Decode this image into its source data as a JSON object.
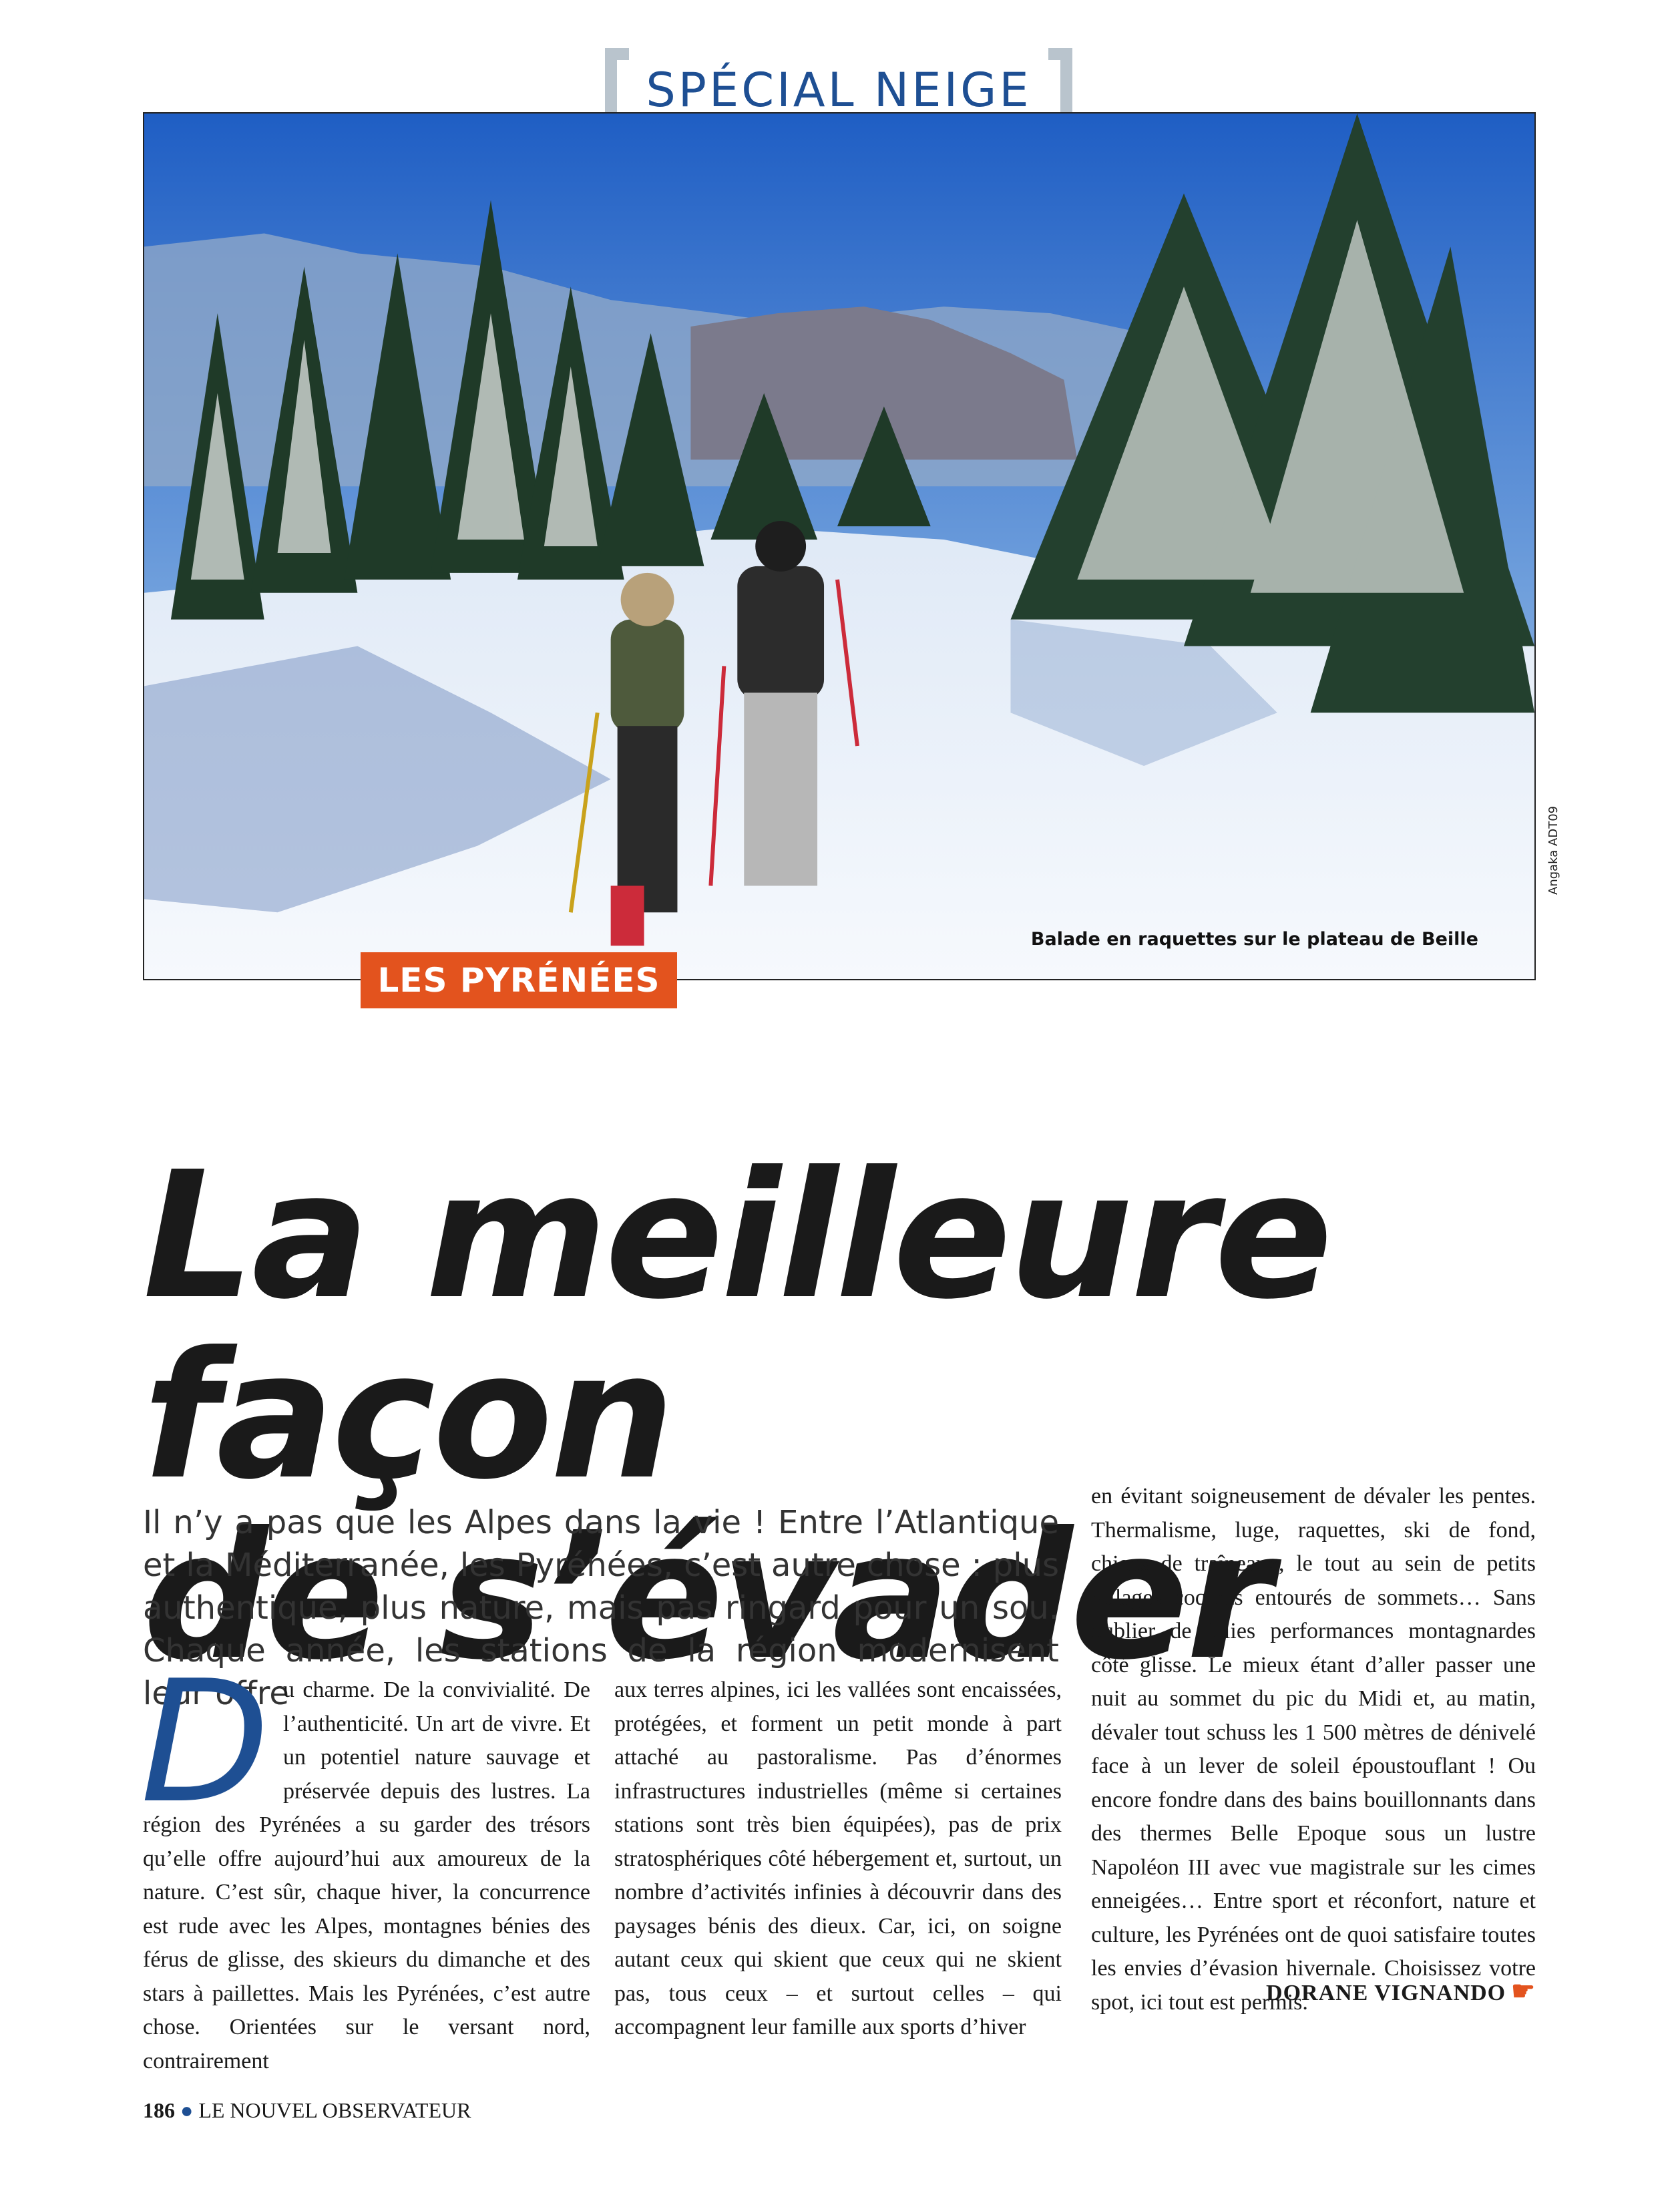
{
  "section": {
    "title": "SPÉCIAL NEIGE"
  },
  "photo": {
    "caption": "Balade en raquettes sur le plateau de Beille",
    "credit": "Angaka ADT09"
  },
  "region_tag": "LES PYRÉNÉES",
  "headline": {
    "line1": "La meilleure façon",
    "line2": "de s’évader"
  },
  "lead": "Il n’y a pas que les Alpes dans la vie ! Entre l’Atlantique et la Méditerranée, les Pyrénées, c’est autre chose  : plus authentique, plus nature, mais pas ringard pour un sou. Chaque année, les stations de la région modernisent leur offre",
  "body": {
    "dropcap": "D",
    "col1": "u charme. De la convivialité. De l’authenticité. Un art de vivre. Et un potentiel nature sauvage et préservée depuis des lustres. La région des Pyrénées a su garder des trésors qu’elle offre aujourd’hui aux amoureux de la nature. C’est sûr, chaque hiver, la concurrence est rude avec les Alpes, montagnes bénies des férus de glisse, des skieurs du dimanche et des stars à paillettes. Mais les Pyrénées, c’est autre chose. Orientées sur le versant nord, contrairement",
    "col2": "aux terres alpines, ici les vallées sont encaissées, protégées, et forment un petit monde à part attaché au pastoralisme. Pas d’énormes infrastructures industrielles (même si certaines stations sont très bien équipées), pas de prix stratosphériques côté hébergement et, surtout, un nombre d’activités infinies à découvrir dans des paysages bénis des dieux. Car, ici, on soigne autant ceux qui skient que ceux qui ne skient pas, tous ceux – et surtout celles – qui accompagnent leur famille aux sports d’hiver",
    "col3": "en évitant soigneusement de dévaler les pentes. Thermalisme, luge, raquettes, ski de fond, chiens de traîneaux, le tout au sein de petits villages coquets entourés de sommets… Sans oublier de jolies performances montagnardes côté glisse. Le mieux étant d’aller passer une nuit au sommet du pic du Midi et, au matin, dévaler tout schuss les 1 500 mètres de dénivelé face à un lever de soleil époustouflant ! Ou encore fondre dans des bains bouillonnants dans des thermes Belle Epoque sous un lustre Napoléon III avec vue magistrale sur les cimes enneigées… Entre sport et réconfort, nature et culture, les Pyrénées ont de quoi satisfaire toutes les envies d’évasion hivernale. Choisissez votre spot, ici tout est permis."
  },
  "author": "DORANE VIGNANDO",
  "footer": {
    "page_number": "186",
    "publication": "LE NOUVEL OBSERVATEUR"
  },
  "colors": {
    "accent_blue": "#1e4f93",
    "tag_orange": "#e3531e",
    "bracket_gray": "#b9c4cd"
  }
}
